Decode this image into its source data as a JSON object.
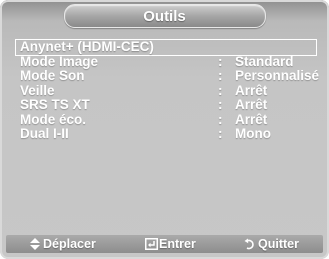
{
  "menu": {
    "title": "Outils",
    "items": [
      {
        "label": "Anynet+ (HDMI-CEC)",
        "sep": "",
        "value": "",
        "selected": true
      },
      {
        "label": "Mode Image",
        "sep": ":",
        "value": "Standard"
      },
      {
        "label": "Mode Son",
        "sep": ":",
        "value": "Personnalisé"
      },
      {
        "label": "Veille",
        "sep": ":",
        "value": "Arrêt"
      },
      {
        "label": "SRS TS XT",
        "sep": ":",
        "value": "Arrêt"
      },
      {
        "label": "Mode éco.",
        "sep": ":",
        "value": "Arrêt"
      },
      {
        "label": "Dual I-II",
        "sep": ":",
        "value": "Mono"
      }
    ]
  },
  "footer": {
    "move_label": "Déplacer",
    "enter_label": "Entrer",
    "quit_label": "Quitter",
    "move_icon": "up-down-arrow-icon",
    "enter_icon": "enter-icon",
    "quit_icon": "return-icon"
  },
  "colors": {
    "text": "#ffffff",
    "background": "#c4c4c4",
    "title_bar": "#9a9a9a",
    "footer_bar": "#9a9a9a"
  }
}
